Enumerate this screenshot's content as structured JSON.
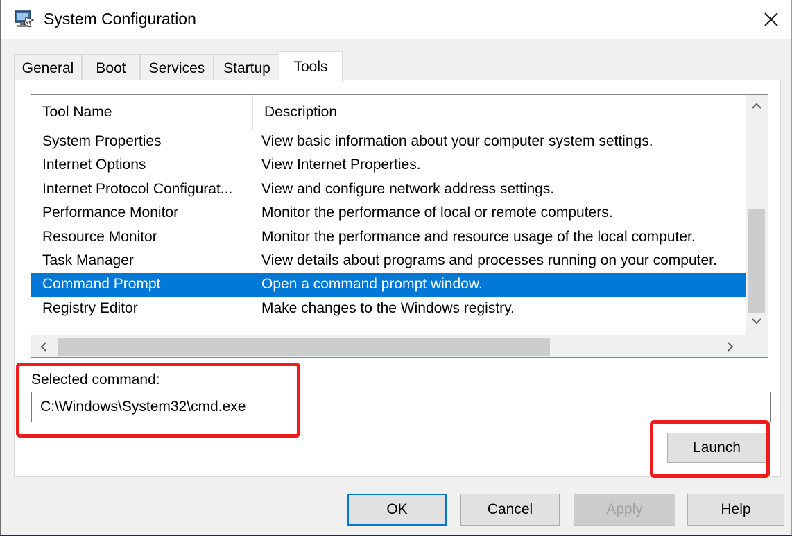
{
  "window": {
    "title": "System Configuration",
    "icon": "system-configuration-icon",
    "close_icon": "close-icon"
  },
  "tabs": [
    {
      "label": "General",
      "active": false
    },
    {
      "label": "Boot",
      "active": false
    },
    {
      "label": "Services",
      "active": false
    },
    {
      "label": "Startup",
      "active": false
    },
    {
      "label": "Tools",
      "active": true
    }
  ],
  "tools_list": {
    "columns": [
      "Tool Name",
      "Description"
    ],
    "rows": [
      {
        "name": "System Properties",
        "description": "View basic information about your computer system settings.",
        "selected": false
      },
      {
        "name": "Internet Options",
        "description": "View Internet Properties.",
        "selected": false
      },
      {
        "name": "Internet Protocol Configurat...",
        "description": "View and configure network address settings.",
        "selected": false
      },
      {
        "name": "Performance Monitor",
        "description": "Monitor the performance of local or remote computers.",
        "selected": false
      },
      {
        "name": "Resource Monitor",
        "description": "Monitor the performance and resource usage of the local computer.",
        "selected": false
      },
      {
        "name": "Task Manager",
        "description": "View details about programs and processes running on your computer.",
        "selected": false
      },
      {
        "name": "Command Prompt",
        "description": "Open a command prompt window.",
        "selected": true
      },
      {
        "name": "Registry Editor",
        "description": "Make changes to the Windows registry.",
        "selected": false
      }
    ]
  },
  "selected_command": {
    "label": "Selected command:",
    "value": "C:\\Windows\\System32\\cmd.exe"
  },
  "buttons": {
    "launch": "Launch",
    "ok": "OK",
    "cancel": "Cancel",
    "apply": "Apply",
    "help": "Help"
  },
  "colors": {
    "selection": "#0078d7",
    "annotation": "#ee1c1c"
  }
}
